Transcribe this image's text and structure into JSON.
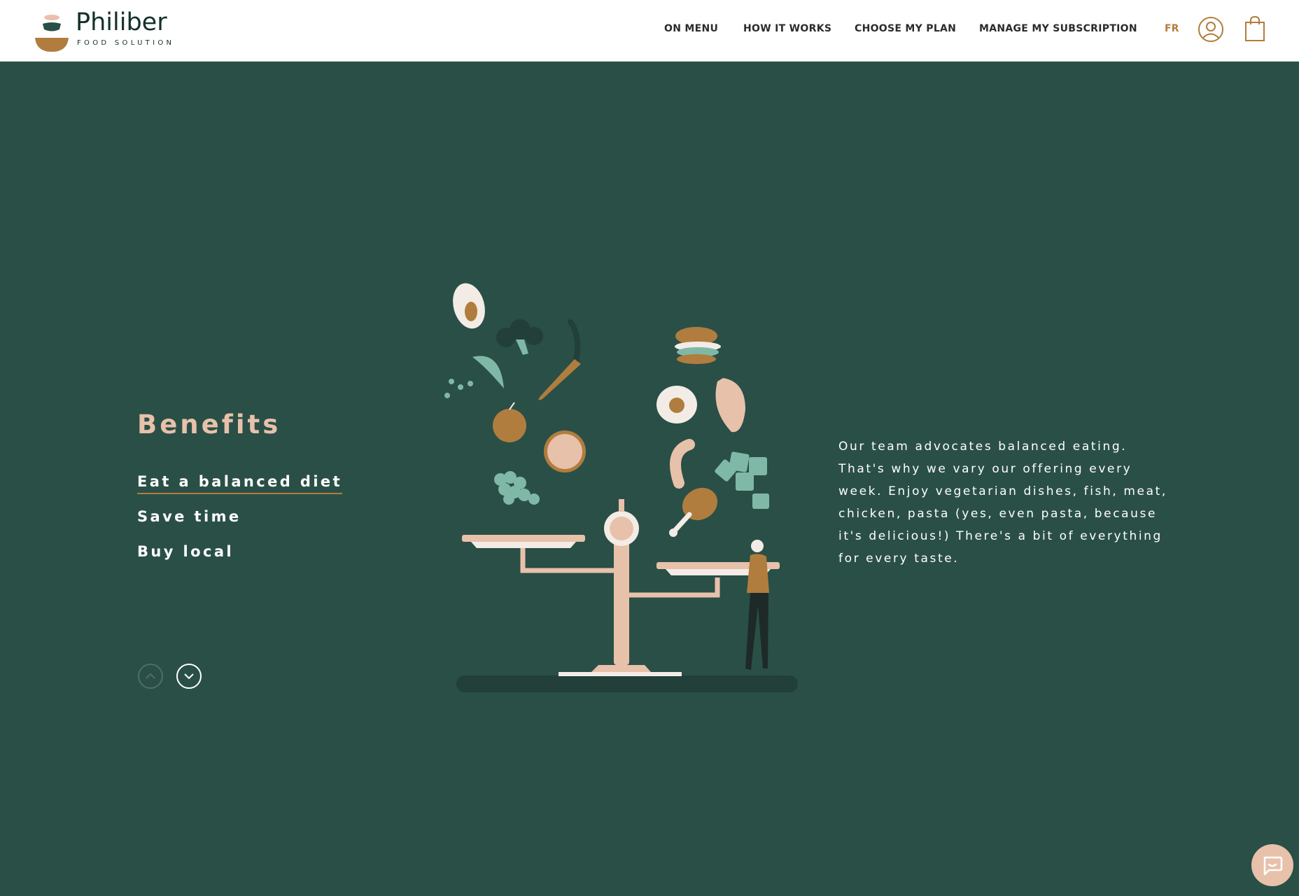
{
  "header": {
    "brand_name": "Philiber",
    "brand_tagline": "FOOD SOLUTION",
    "nav": [
      {
        "label": "ON MENU"
      },
      {
        "label": "HOW IT WORKS"
      },
      {
        "label": "CHOOSE MY PLAN"
      },
      {
        "label": "MANAGE MY SUBSCRIPTION"
      }
    ],
    "language": "FR",
    "icons": {
      "account": "user-icon",
      "cart": "shopping-bag-icon"
    }
  },
  "benefits": {
    "title": "Benefits",
    "items": [
      {
        "label": "Eat a balanced diet",
        "active": true
      },
      {
        "label": "Save time",
        "active": false
      },
      {
        "label": "Buy local",
        "active": false
      }
    ],
    "controls": {
      "prev": "chevron-up-icon",
      "next": "chevron-down-icon"
    }
  },
  "description": "Our team advocates balanced eating. That's why we vary our offering every week. Enjoy vegetarian dishes, fish, meat, chicken, pasta (yes, even pasta, because it's delicious!) There's a bit of everything for every taste.",
  "chat": {
    "icon": "chat-bubble-icon"
  },
  "colors": {
    "background": "#2a4f47",
    "accent": "#b07d3e",
    "peach": "#e8c1ab",
    "header": "#ffffff"
  }
}
